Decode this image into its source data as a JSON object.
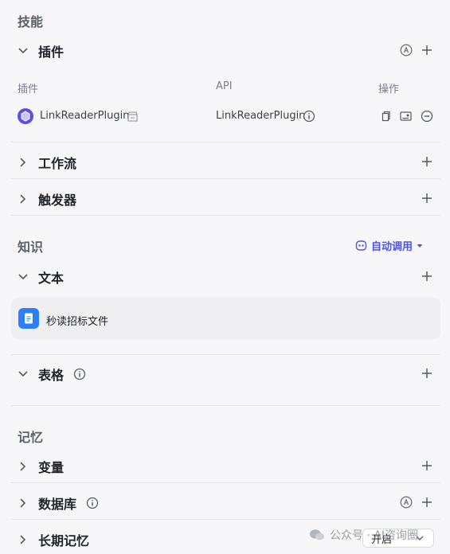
{
  "skills": {
    "title": "技能",
    "plugins": {
      "label": "插件",
      "columns": [
        "插件",
        "API",
        "操作"
      ],
      "rows": [
        {
          "plugin": "LinkReaderPlugin",
          "api": "LinkReaderPlugin"
        }
      ]
    },
    "workflow": {
      "label": "工作流"
    },
    "trigger": {
      "label": "触发器"
    }
  },
  "knowledge": {
    "title": "知识",
    "auto_call_label": "自动调用",
    "text": {
      "label": "文本",
      "items": [
        "秒读招标文件"
      ]
    },
    "table": {
      "label": "表格"
    }
  },
  "memory": {
    "title": "记忆",
    "variables": {
      "label": "变量"
    },
    "database": {
      "label": "数据库"
    },
    "longterm": {
      "label": "长期记忆",
      "toggle_label": "开启"
    }
  },
  "watermark": {
    "text": "公众号 · AI咨询圈"
  },
  "colors": {
    "accent": "#4d53e8",
    "chip": "#2d7ff9"
  }
}
